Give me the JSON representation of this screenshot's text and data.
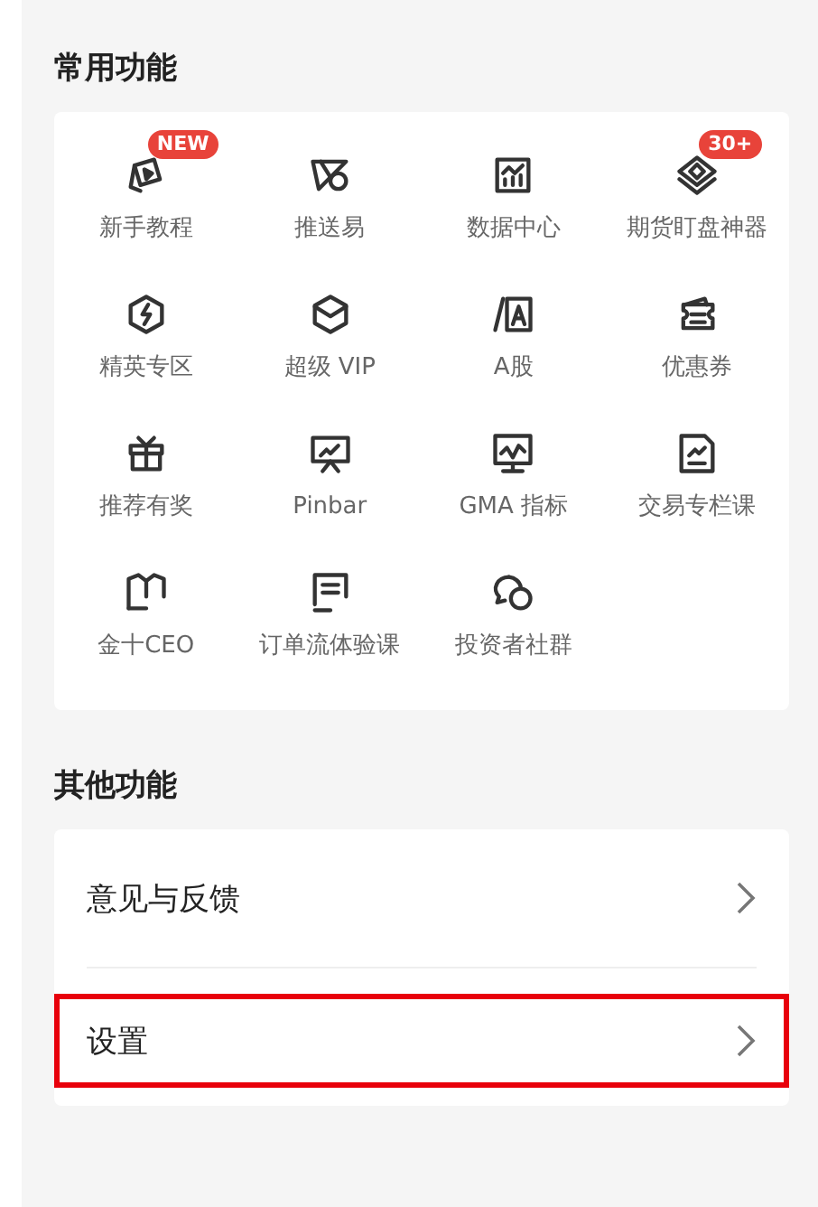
{
  "common": {
    "title": "常用功能",
    "items": [
      {
        "label": "新手教程",
        "badge": "NEW"
      },
      {
        "label": "推送易"
      },
      {
        "label": "数据中心"
      },
      {
        "label": "期货盯盘神器",
        "badge": "30+"
      },
      {
        "label": "精英专区"
      },
      {
        "label": "超级 VIP"
      },
      {
        "label": "A股"
      },
      {
        "label": "优惠券"
      },
      {
        "label": "推荐有奖"
      },
      {
        "label": "Pinbar"
      },
      {
        "label": "GMA 指标"
      },
      {
        "label": "交易专栏课"
      },
      {
        "label": "金十CEO"
      },
      {
        "label": "订单流体验课"
      },
      {
        "label": "投资者社群"
      }
    ]
  },
  "other": {
    "title": "其他功能",
    "items": [
      {
        "label": "意见与反馈",
        "highlighted": false
      },
      {
        "label": "设置",
        "highlighted": true
      }
    ]
  }
}
